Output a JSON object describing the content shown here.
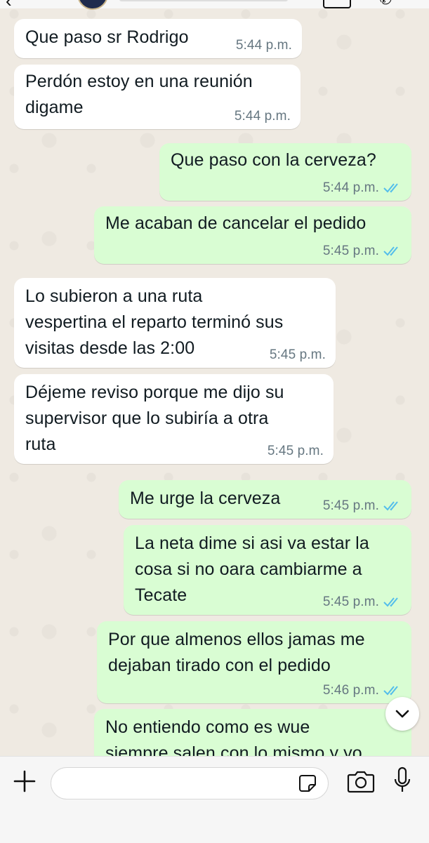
{
  "chat": {
    "messages": [
      {
        "dir": "in",
        "text": "Que paso sr Rodrigo",
        "time": "5:44 p.m."
      },
      {
        "dir": "in",
        "text": "Perdón estoy en una reunión\ndigame",
        "time": "5:44 p.m."
      },
      {
        "dir": "out",
        "text": "Que paso con la cerveza?",
        "time": "5:44 p.m.",
        "status": "read"
      },
      {
        "dir": "out",
        "text": "Me acaban de cancelar el pedido",
        "time": "5:45 p.m.",
        "status": "read"
      },
      {
        "dir": "in",
        "text": "Lo subieron a una ruta\nvespertina el reparto terminó sus\nvisitas desde las 2:00",
        "time": "5:45 p.m."
      },
      {
        "dir": "in",
        "text": "Déjeme reviso porque me dijo su\nsupervisor que lo subiría a otra\nruta",
        "time": "5:45 p.m."
      },
      {
        "dir": "out",
        "text": "Me urge la cerveza",
        "time": "5:45 p.m.",
        "status": "read"
      },
      {
        "dir": "out",
        "text": "La neta dime si asi va estar la\ncosa si no oara cambiarme a\nTecate",
        "time": "5:45 p.m.",
        "status": "read"
      },
      {
        "dir": "out",
        "text": "Por que almenos ellos jamas me\ndejaban tirado con el pedido",
        "time": "5:46 p.m.",
        "status": "read"
      },
      {
        "dir": "out",
        "text": "No entiendo como es wue\nsiempre salen con lo mismo y yo",
        "time": "",
        "status": ""
      }
    ]
  },
  "composer": {
    "placeholder": "",
    "icons": [
      "plus-icon",
      "sticker-icon",
      "camera-icon",
      "mic-icon"
    ]
  },
  "colors": {
    "incoming_bubble": "#ffffff",
    "outgoing_bubble": "#d9fdd3",
    "read_ticks": "#53bdeb",
    "background": "#efeae2"
  }
}
